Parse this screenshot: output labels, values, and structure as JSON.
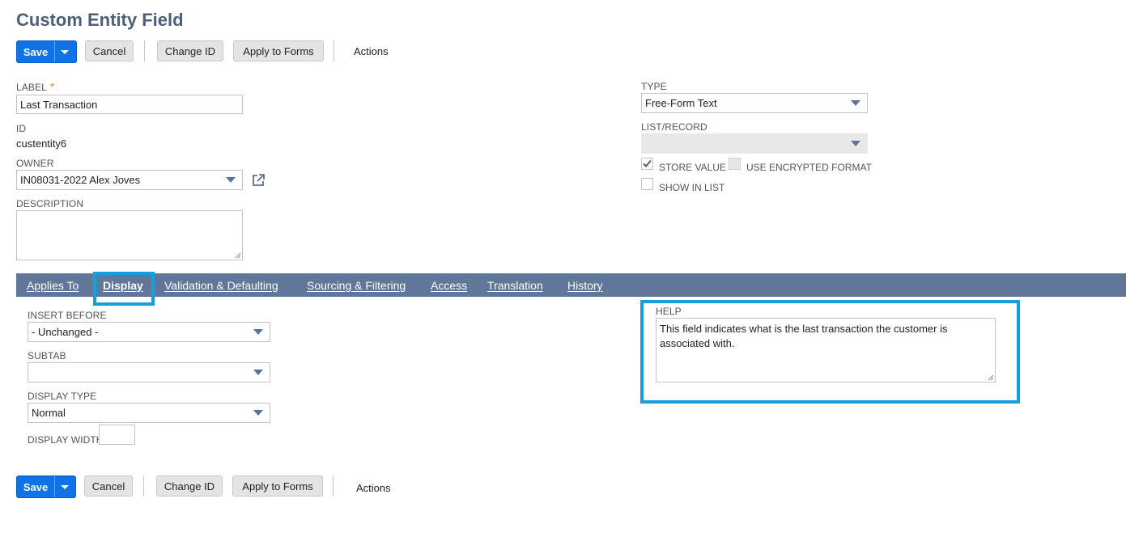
{
  "page": {
    "title": "Custom Entity Field"
  },
  "toolbar": {
    "save_label": "Save",
    "cancel_label": "Cancel",
    "change_id_label": "Change ID",
    "apply_to_forms_label": "Apply to Forms",
    "actions_label": "Actions"
  },
  "fields": {
    "label": {
      "label": "LABEL",
      "required_mark": "*",
      "value": "Last Transaction"
    },
    "id": {
      "label": "ID",
      "value": "custentity6"
    },
    "owner": {
      "label": "OWNER",
      "value": "IN08031-2022 Alex Joves"
    },
    "description": {
      "label": "DESCRIPTION",
      "value": ""
    },
    "type": {
      "label": "TYPE",
      "value": "Free-Form Text"
    },
    "list_record": {
      "label": "LIST/RECORD",
      "value": ""
    },
    "store_value": {
      "label": "STORE VALUE",
      "checked": true
    },
    "use_encrypted_format": {
      "label": "USE ENCRYPTED FORMAT",
      "checked": false
    },
    "show_in_list": {
      "label": "SHOW IN LIST",
      "checked": false
    }
  },
  "tabs": [
    {
      "label": "Applies To",
      "active": false
    },
    {
      "label": "Display",
      "active": true
    },
    {
      "label": "Validation & Defaulting",
      "active": false
    },
    {
      "label": "Sourcing & Filtering",
      "active": false
    },
    {
      "label": "Access",
      "active": false
    },
    {
      "label": "Translation",
      "active": false
    },
    {
      "label": "History",
      "active": false
    }
  ],
  "display_tab": {
    "insert_before": {
      "label": "INSERT BEFORE",
      "value": "- Unchanged -"
    },
    "subtab": {
      "label": "SUBTAB",
      "value": ""
    },
    "display_type": {
      "label": "DISPLAY TYPE",
      "value": "Normal"
    },
    "display_width": {
      "label": "DISPLAY WIDTH",
      "value": ""
    },
    "help": {
      "label": "HELP",
      "value": "This field indicates what is the last transaction the customer is associated with."
    }
  },
  "colors": {
    "primary_button": "#0f72e6",
    "tab_bar": "#607799",
    "highlight": "#13a0dc",
    "required": "#f08a24",
    "title": "#4d5f79"
  },
  "icons": {
    "open_record": "external-link-icon",
    "checkbox_checked": "checkmark-icon",
    "dropdown": "chevron-down-icon"
  }
}
